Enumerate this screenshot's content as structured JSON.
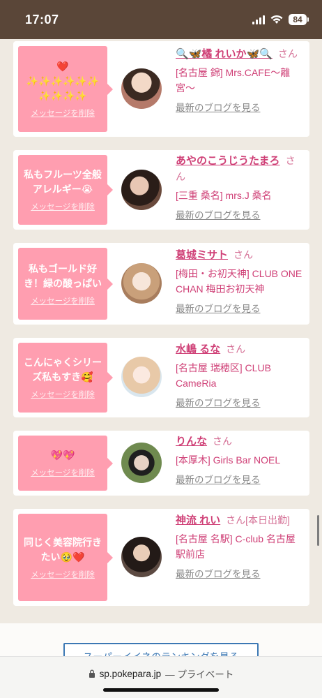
{
  "status": {
    "time": "17:07",
    "battery": "84"
  },
  "cards": [
    {
      "message_emoji": "❤️",
      "message": "✨✨✨✨✨✨\n✨✨✨✨",
      "delete_label": "メッセージを削除",
      "name": "🔍🦋橘 れいか🦋🔍",
      "san": "さん",
      "shop": "[名古屋 錦] Mrs.CAFE〜離宮〜",
      "blog_link": "最新のブログを見る"
    },
    {
      "message": "私もフルーツ全般アレルギー😭",
      "delete_label": "メッセージを削除",
      "name": "あやのこうじうたまろ",
      "san": "さん",
      "shop": "[三重 桑名] mrs.J 桑名",
      "blog_link": "最新のブログを見る"
    },
    {
      "message": "私もゴールド好き！緑の酸っぱい",
      "delete_label": "メッセージを削除",
      "name": "葛城ミサト",
      "san": "さん",
      "shop": "[梅田・お初天神] CLUB ONE CHAN 梅田お初天神",
      "blog_link": "最新のブログを見る"
    },
    {
      "message": "こんにゃくシリーズ私もすき🥰",
      "delete_label": "メッセージを削除",
      "name": "水嶋 るな",
      "san": "さん",
      "shop": "[名古屋 瑞穂区] CLUB CameRia",
      "blog_link": "最新のブログを見る"
    },
    {
      "message": "💖💖",
      "delete_label": "メッセージを削除",
      "name": "りんな",
      "san": "さん",
      "shop": "[本厚木] Girls Bar NOEL",
      "blog_link": "最新のブログを見る"
    },
    {
      "message": "同じく美容院行きたい🥹❤️",
      "delete_label": "メッセージを削除",
      "name": "神流 れい",
      "san": "さん[本日出勤]",
      "shop": "[名古屋 名駅] C-club 名古屋駅前店",
      "blog_link": "最新のブログを見る"
    }
  ],
  "ranking_button": "スーパーイイネのランキングを見る",
  "browser": {
    "url": "sp.pokepara.jp",
    "private_label": "— プライベート"
  },
  "colors": {
    "accent_pink": "#cf3f76",
    "bubble_pink": "#ff9eb0",
    "status_bar": "#5a4638"
  }
}
